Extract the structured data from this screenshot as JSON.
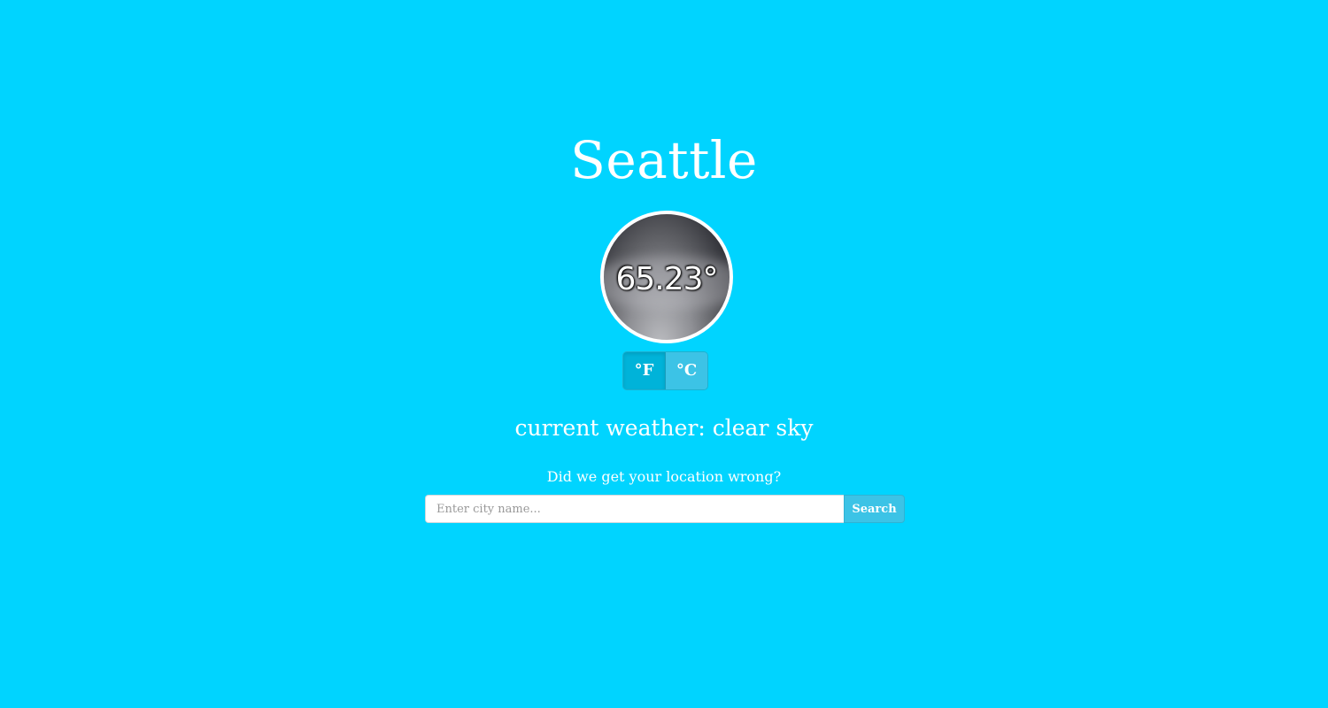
{
  "location": {
    "city": "Seattle"
  },
  "temperature": {
    "value": "65.23°"
  },
  "units": {
    "fahrenheit_label": "°F",
    "celsius_label": "°C",
    "selected": "°F"
  },
  "weather": {
    "description": "current weather: clear sky"
  },
  "location_search": {
    "prompt": "Did we get your location wrong?",
    "placeholder": "Enter city name...",
    "value": "",
    "button_label": "Search"
  },
  "colors": {
    "background": "#00d4ff",
    "button": "#3cc3e6",
    "button_active": "#00b3d9",
    "text": "#ffffff"
  }
}
